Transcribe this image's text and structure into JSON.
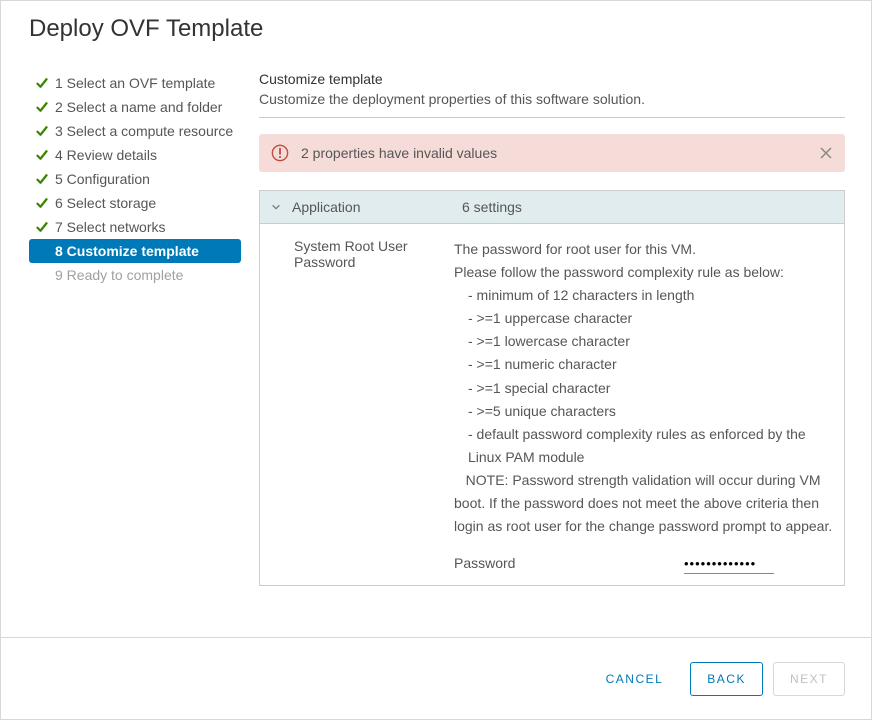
{
  "dialog_title": "Deploy OVF Template",
  "steps": [
    {
      "label": "1 Select an OVF template",
      "state": "done"
    },
    {
      "label": "2 Select a name and folder",
      "state": "done"
    },
    {
      "label": "3 Select a compute resource",
      "state": "done"
    },
    {
      "label": "4 Review details",
      "state": "done"
    },
    {
      "label": "5 Configuration",
      "state": "done"
    },
    {
      "label": "6 Select storage",
      "state": "done"
    },
    {
      "label": "7 Select networks",
      "state": "done"
    },
    {
      "label": "8 Customize template",
      "state": "active"
    },
    {
      "label": "9 Ready to complete",
      "state": "disabled"
    }
  ],
  "section": {
    "title": "Customize template",
    "subtitle": "Customize the deployment properties of this software solution."
  },
  "alert": {
    "text": "2 properties have invalid values"
  },
  "panel": {
    "header_label": "Application",
    "header_count": "6 settings",
    "setting": {
      "label": "System Root User Password",
      "desc_lead": "The password for root user for this VM.",
      "desc_rule_intro": "Please follow the password complexity rule as below:",
      "rules": [
        "- minimum of 12 characters in length",
        "- >=1 uppercase character",
        "- >=1 lowercase character",
        "- >=1 numeric character",
        "- >=1 special character",
        "- >=5 unique characters",
        "- default password complexity rules as enforced by the Linux PAM module"
      ],
      "note": "   NOTE: Password strength validation will occur during VM boot.  If the password does not meet the above criteria then login as root user for the change password prompt to appear.",
      "password_label": "Password",
      "password_value": "•••••••••••••"
    }
  },
  "footer": {
    "cancel": "CANCEL",
    "back": "BACK",
    "next": "NEXT"
  },
  "colors": {
    "accent": "#0079b8",
    "check": "#3c8500",
    "alert_icon": "#c14a3a"
  }
}
